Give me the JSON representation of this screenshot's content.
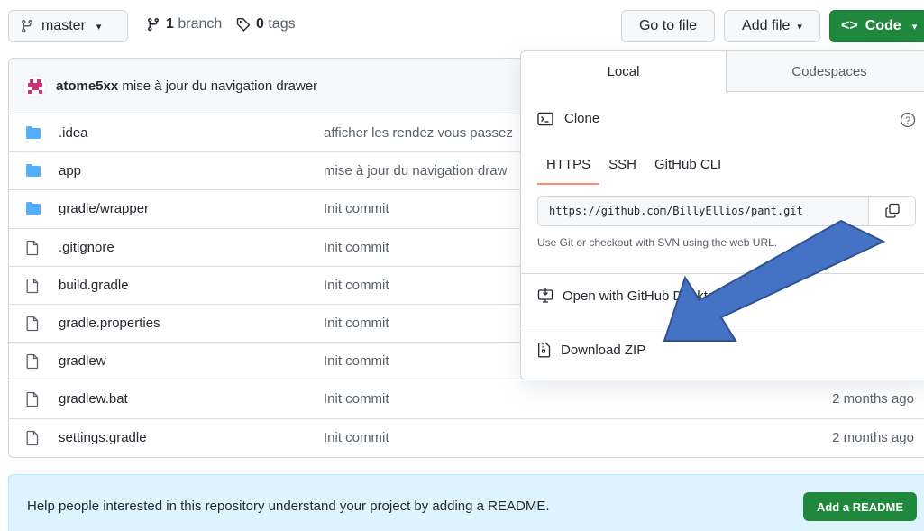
{
  "topbar": {
    "branch_label": "master",
    "branch_count": "1",
    "branch_word": "branch",
    "tag_count": "0",
    "tag_word": "tags",
    "goto_label": "Go to file",
    "addfile_label": "Add file",
    "code_label": "Code"
  },
  "commit": {
    "author": "atome5xx",
    "message": "mise à jour du navigation drawer"
  },
  "files": [
    {
      "type": "folder",
      "name": ".idea",
      "message": "afficher les rendez vous passez",
      "age": ""
    },
    {
      "type": "folder",
      "name": "app",
      "message": "mise à jour du navigation draw",
      "age": ""
    },
    {
      "type": "folder",
      "name": "gradle/wrapper",
      "message": "Init commit",
      "age": ""
    },
    {
      "type": "file",
      "name": ".gitignore",
      "message": "Init commit",
      "age": ""
    },
    {
      "type": "file",
      "name": "build.gradle",
      "message": "Init commit",
      "age": ""
    },
    {
      "type": "file",
      "name": "gradle.properties",
      "message": "Init commit",
      "age": ""
    },
    {
      "type": "file",
      "name": "gradlew",
      "message": "Init commit",
      "age": ""
    },
    {
      "type": "file",
      "name": "gradlew.bat",
      "message": "Init commit",
      "age": "2 months ago"
    },
    {
      "type": "file",
      "name": "settings.gradle",
      "message": "Init commit",
      "age": "2 months ago"
    }
  ],
  "readme": {
    "text": "Help people interested in this repository understand your project by adding a README.",
    "button": "Add a README"
  },
  "dropdown": {
    "tab_local": "Local",
    "tab_codespaces": "Codespaces",
    "clone_title": "Clone",
    "protocols": [
      "HTTPS",
      "SSH",
      "GitHub CLI"
    ],
    "url": "https://github.com/BillyEllios/pant.git",
    "hint": "Use Git or checkout with SVN using the web URL.",
    "open_desktop": "Open with GitHub Desktop",
    "download_zip": "Download ZIP"
  },
  "colors": {
    "primary_green": "#1f883d",
    "arrow_fill": "#4472c4",
    "arrow_stroke": "#2f528f",
    "folder_blue": "#54aeff"
  }
}
